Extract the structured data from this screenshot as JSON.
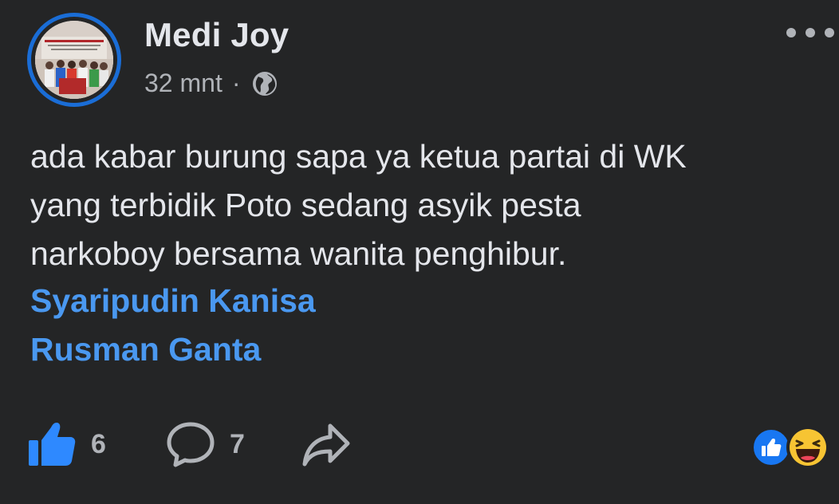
{
  "author": {
    "name": "Medi Joy",
    "time": "32 mnt",
    "separator": "·",
    "privacy_icon": "globe-icon"
  },
  "post": {
    "text": "ada kabar burung sapa ya ketua partai di WK\nyang terbidik Poto sedang asyik pesta\nnarkoboy bersama wanita penghibur.",
    "mentions": [
      "Syaripudin Kanisa",
      "Rusman Ganta"
    ]
  },
  "actions": {
    "like": {
      "icon": "thumbs-up-icon",
      "count": "6"
    },
    "comment": {
      "icon": "comment-bubble-icon",
      "count": "7"
    },
    "share": {
      "icon": "share-arrow-icon"
    }
  },
  "reactions": [
    "like-reaction-icon",
    "haha-reaction-icon"
  ],
  "colors": {
    "background": "#242526",
    "text": "#e4e6eb",
    "muted": "#b0b3b8",
    "link": "#4a98f0",
    "avatar_ring": "#1a6dd6",
    "like_blue": "#1877f2",
    "haha_yellow": "#f7c433"
  }
}
